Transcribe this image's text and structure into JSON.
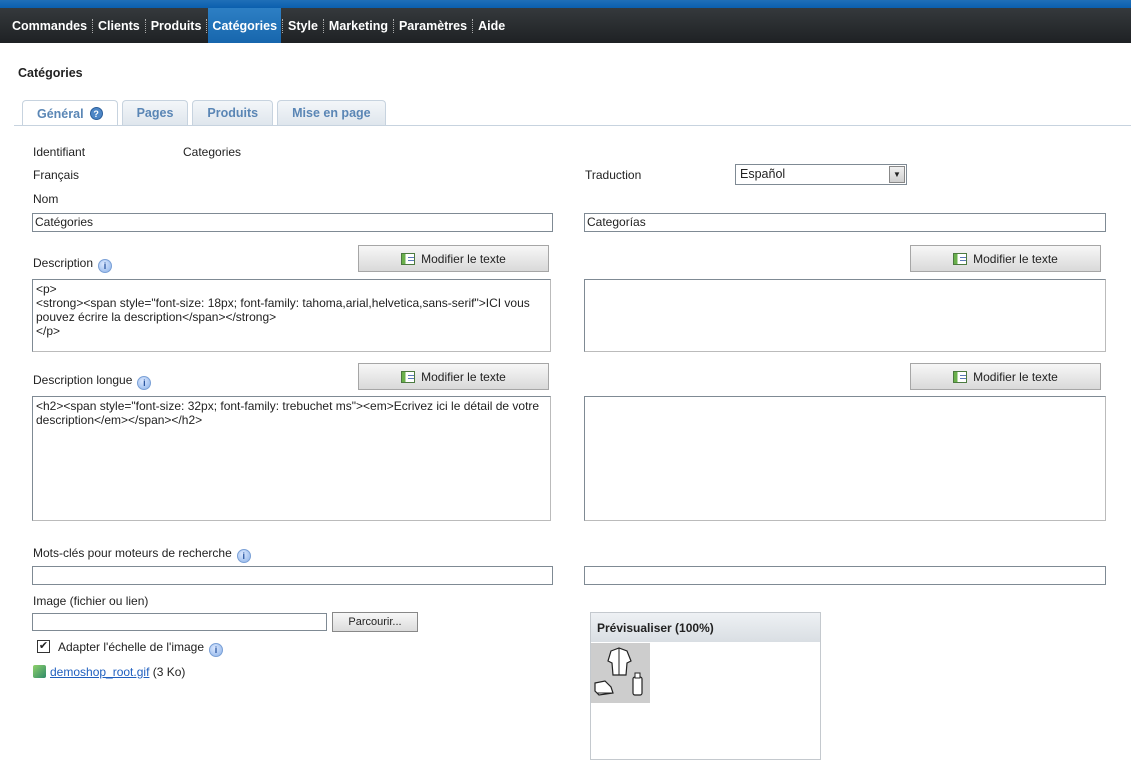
{
  "nav": {
    "items": [
      "Commandes",
      "Clients",
      "Produits",
      "Catégories",
      "Style",
      "Marketing",
      "Paramètres",
      "Aide"
    ],
    "active": "Catégories"
  },
  "page": {
    "title": "Catégories"
  },
  "tabs": {
    "general": "Général",
    "pages": "Pages",
    "products": "Produits",
    "layout": "Mise en page"
  },
  "form": {
    "identifier_label": "Identifiant",
    "identifier_value": "Categories",
    "source_language": "Français",
    "translation_label": "Traduction",
    "translation_value": "Español",
    "name_label": "Nom",
    "name_fr": "Catégories",
    "name_es": "Categorías",
    "description_label": "Description",
    "edit_text_label": "Modifier le texte",
    "description_fr": "<p>\n<strong><span style=\"font-size: 18px; font-family: tahoma,arial,helvetica,sans-serif\">ICI vous pouvez écrire la description</span></strong>\n</p>",
    "description_es": "",
    "long_description_label": "Description longue",
    "long_description_fr": "<h2><span style=\"font-size: 32px; font-family: trebuchet ms\"><em>Ecrivez ici le détail de votre description</em></span></h2>",
    "long_description_es": "",
    "keywords_label": "Mots-clés pour moteurs de recherche",
    "keywords_fr": "",
    "keywords_es": "",
    "image_label": "Image (fichier ou lien)",
    "image_value": "",
    "browse_label": "Parcourir...",
    "scale_label": "Adapter l'échelle de l'image",
    "scale_checked": true,
    "file_name": "demoshop_root.gif",
    "file_size": "(3 Ko)",
    "preview_label": "Prévisualiser (100%)"
  }
}
